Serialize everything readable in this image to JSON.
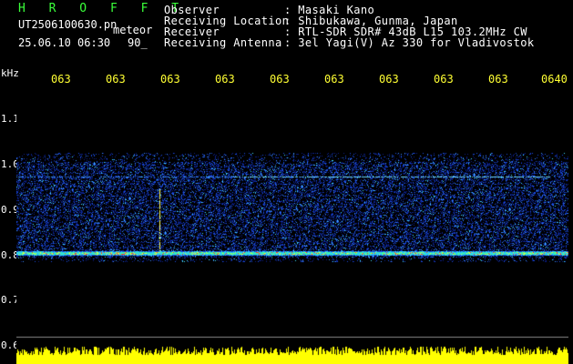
{
  "app": {
    "brand": "H R O F F T"
  },
  "file": {
    "filename": "UT2506100630.pn",
    "tag": "meteor",
    "datetime": "25.06.10 06:30",
    "value": "90_"
  },
  "meta": {
    "labels": [
      "Observer",
      "Receiving Location",
      "Receiver",
      "Receiving Antenna"
    ],
    "values": [
      ": Masaki Kano",
      ": Shibukawa, Gunma, Japan",
      ": RTL-SDR SDR# 43dB L15 103.2MHz CW",
      ": 3el Yagi(V) Az 330 for Vladivostok"
    ]
  },
  "time_axis": {
    "labels": [
      "063",
      "063",
      "063",
      "063",
      "063",
      "063",
      "063",
      "063",
      "063",
      "0640"
    ]
  },
  "freq_axis": {
    "unit": "kHz",
    "labels": [
      "1.1",
      "1.0",
      "0.9",
      "0.8",
      "0.7",
      "0.6"
    ]
  },
  "colors": {
    "brand": "#3aff3a",
    "tick": "#ffff33",
    "signal_band": "#ffff00"
  }
}
